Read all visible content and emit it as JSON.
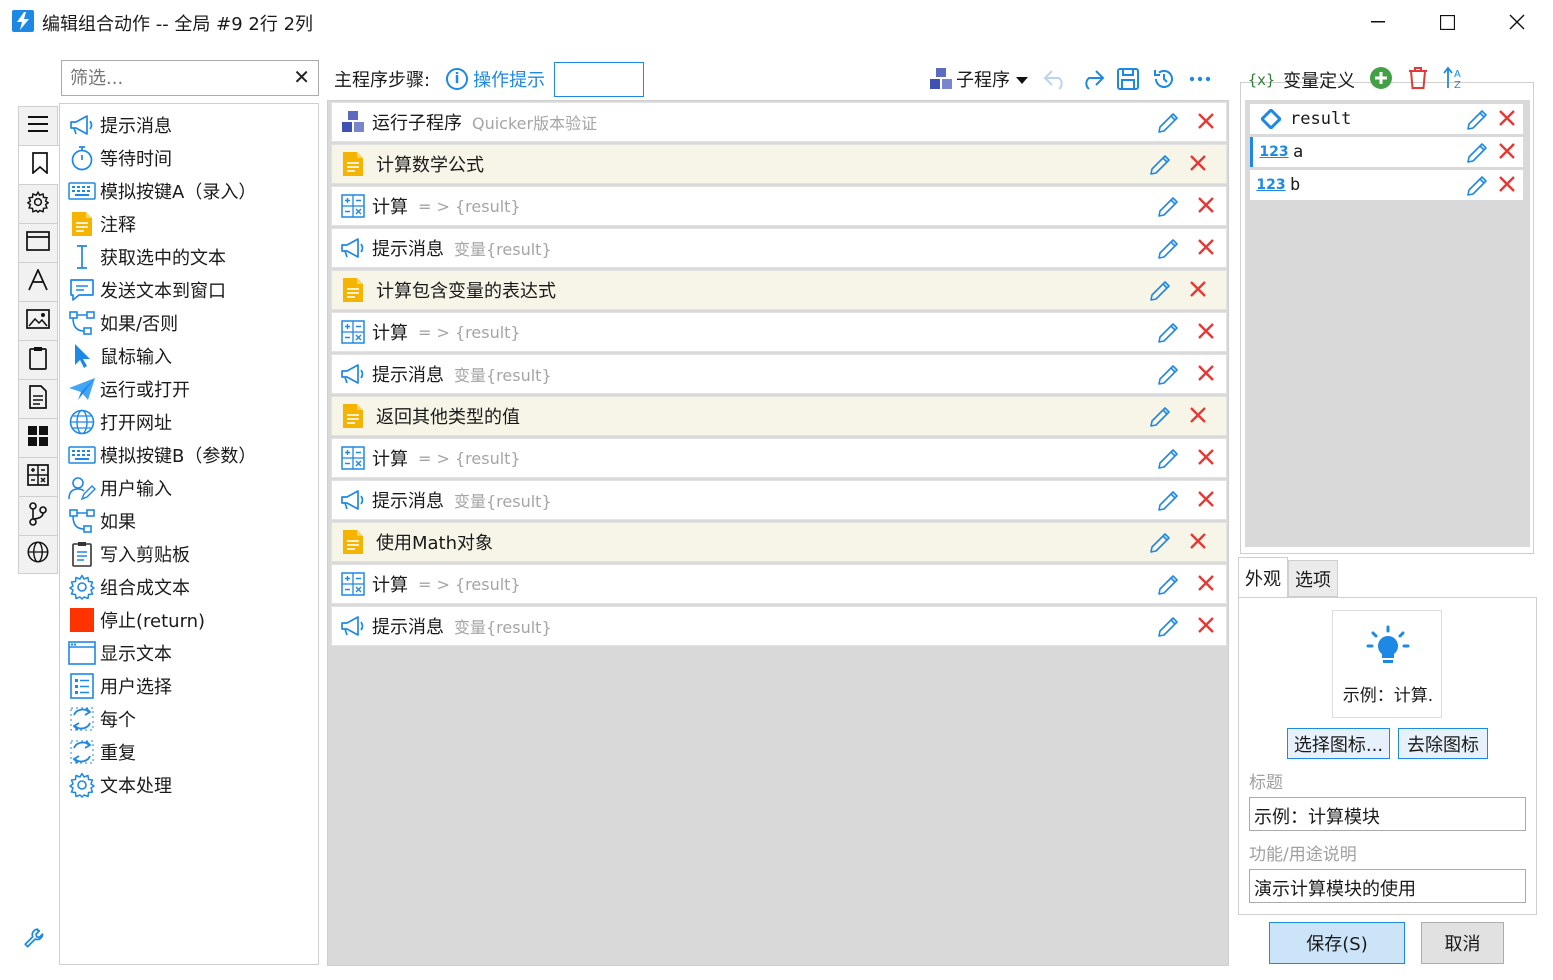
{
  "window": {
    "title": "编辑组合动作 -- 全局 #9 2行 2列"
  },
  "filter": {
    "placeholder": "筛选..."
  },
  "rail_icons": [
    "list-icon",
    "bookmark-icon",
    "gear-icon",
    "window-icon",
    "font-icon",
    "image-icon",
    "clipboard-icon",
    "document-icon",
    "windows-icon",
    "calculator-icon",
    "branch-icon",
    "globe-icon"
  ],
  "actions": [
    {
      "label": "提示消息",
      "icon": "megaphone-icon"
    },
    {
      "label": "等待时间",
      "icon": "stopwatch-icon"
    },
    {
      "label": "模拟按键A（录入）",
      "icon": "keyboard-icon"
    },
    {
      "label": "注释",
      "icon": "note-icon"
    },
    {
      "label": "获取选中的文本",
      "icon": "text-cursor-icon"
    },
    {
      "label": "发送文本到窗口",
      "icon": "message-icon"
    },
    {
      "label": "如果/否则",
      "icon": "flow-icon"
    },
    {
      "label": "鼠标输入",
      "icon": "mouse-pointer-icon"
    },
    {
      "label": "运行或打开",
      "icon": "paper-plane-icon"
    },
    {
      "label": "打开网址",
      "icon": "globe-icon"
    },
    {
      "label": "模拟按键B（参数）",
      "icon": "keyboard-icon"
    },
    {
      "label": "用户输入",
      "icon": "user-edit-icon"
    },
    {
      "label": "如果",
      "icon": "flow-icon"
    },
    {
      "label": "写入剪贴板",
      "icon": "clipboard-icon"
    },
    {
      "label": "组合成文本",
      "icon": "gear-icon"
    },
    {
      "label": "停止(return)",
      "icon": "stop-icon"
    },
    {
      "label": "显示文本",
      "icon": "window-icon"
    },
    {
      "label": "用户选择",
      "icon": "list-select-icon"
    },
    {
      "label": "每个",
      "icon": "loop-icon"
    },
    {
      "label": "重复",
      "icon": "loop-icon"
    },
    {
      "label": "文本处理",
      "icon": "gear-icon"
    }
  ],
  "main": {
    "title": "主程序步骤:",
    "hint_label": "操作提示",
    "subprogram_label": "子程序"
  },
  "steps": [
    {
      "type": "subprogram",
      "name": "运行子程序",
      "desc": "Quicker版本验证"
    },
    {
      "type": "note",
      "name": "计算数学公式",
      "desc": ""
    },
    {
      "type": "calc",
      "name": "计算",
      "desc": "= > {result}"
    },
    {
      "type": "message",
      "name": "提示消息",
      "desc": "变量{result}"
    },
    {
      "type": "note",
      "name": "计算包含变量的表达式",
      "desc": ""
    },
    {
      "type": "calc",
      "name": "计算",
      "desc": "= > {result}"
    },
    {
      "type": "message",
      "name": "提示消息",
      "desc": "变量{result}"
    },
    {
      "type": "note",
      "name": "返回其他类型的值",
      "desc": ""
    },
    {
      "type": "calc",
      "name": "计算",
      "desc": "= > {result}"
    },
    {
      "type": "message",
      "name": "提示消息",
      "desc": "变量{result}"
    },
    {
      "type": "note",
      "name": "使用Math对象",
      "desc": ""
    },
    {
      "type": "calc",
      "name": "计算",
      "desc": "= > {result}"
    },
    {
      "type": "message",
      "name": "提示消息",
      "desc": "变量{result}"
    }
  ],
  "variables_panel": {
    "title": "变量定义",
    "x_label": "{x}"
  },
  "variables": [
    {
      "name": "result",
      "type": "any"
    },
    {
      "name": "a",
      "type": "number"
    },
    {
      "name": "b",
      "type": "number"
    }
  ],
  "number_type_label": "123",
  "tabs": [
    "外观",
    "选项"
  ],
  "appearance": {
    "preview_caption": "示例：计算.",
    "choose_icon": "选择图标...",
    "remove_icon": "去除图标",
    "title_label": "标题",
    "title_value": "示例：计算模块",
    "desc_label": "功能/用途说明",
    "desc_value": "演示计算模块的使用"
  },
  "buttons": {
    "save": "保存(S)",
    "cancel": "取消"
  },
  "colors": {
    "accent": "#1e88e5",
    "delete": "#e53935",
    "note": "#f4b400",
    "add": "#43a047"
  }
}
